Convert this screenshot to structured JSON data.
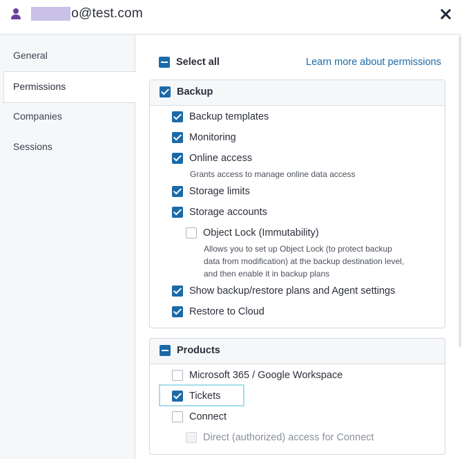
{
  "header": {
    "email_suffix": "o@test.com",
    "email_masked": "xxxxxx"
  },
  "sidebar": {
    "items": [
      {
        "label": "General"
      },
      {
        "label": "Permissions"
      },
      {
        "label": "Companies"
      },
      {
        "label": "Sessions"
      }
    ]
  },
  "permissions": {
    "select_all": "Select all",
    "learn_more": "Learn more about permissions",
    "backup": {
      "title": "Backup",
      "items": [
        {
          "label": "Backup templates"
        },
        {
          "label": "Monitoring"
        },
        {
          "label": "Online access",
          "desc": "Grants access to manage online data access"
        },
        {
          "label": "Storage limits"
        },
        {
          "label": "Storage accounts"
        },
        {
          "label": "Object Lock (Immutability)",
          "desc": [
            "Allows you to set up Object Lock (to protect backup",
            "data from modification) at the backup destination level,",
            "and then enable it in backup plans"
          ]
        },
        {
          "label": "Show backup/restore plans and Agent settings"
        },
        {
          "label": "Restore to Cloud"
        }
      ]
    },
    "products": {
      "title": "Products",
      "items": [
        {
          "label": "Microsoft 365 / Google Workspace"
        },
        {
          "label": "Tickets"
        },
        {
          "label": "Connect"
        },
        {
          "label": "Direct (authorized) access for Connect"
        }
      ]
    }
  },
  "colors": {
    "accent": "#1b6aa8",
    "user_icon": "#6b3fa0",
    "highlight": "#a6dde8",
    "redaction": "#c9c1e8"
  },
  "icons": {
    "user": "user-icon",
    "close": "close-icon"
  }
}
